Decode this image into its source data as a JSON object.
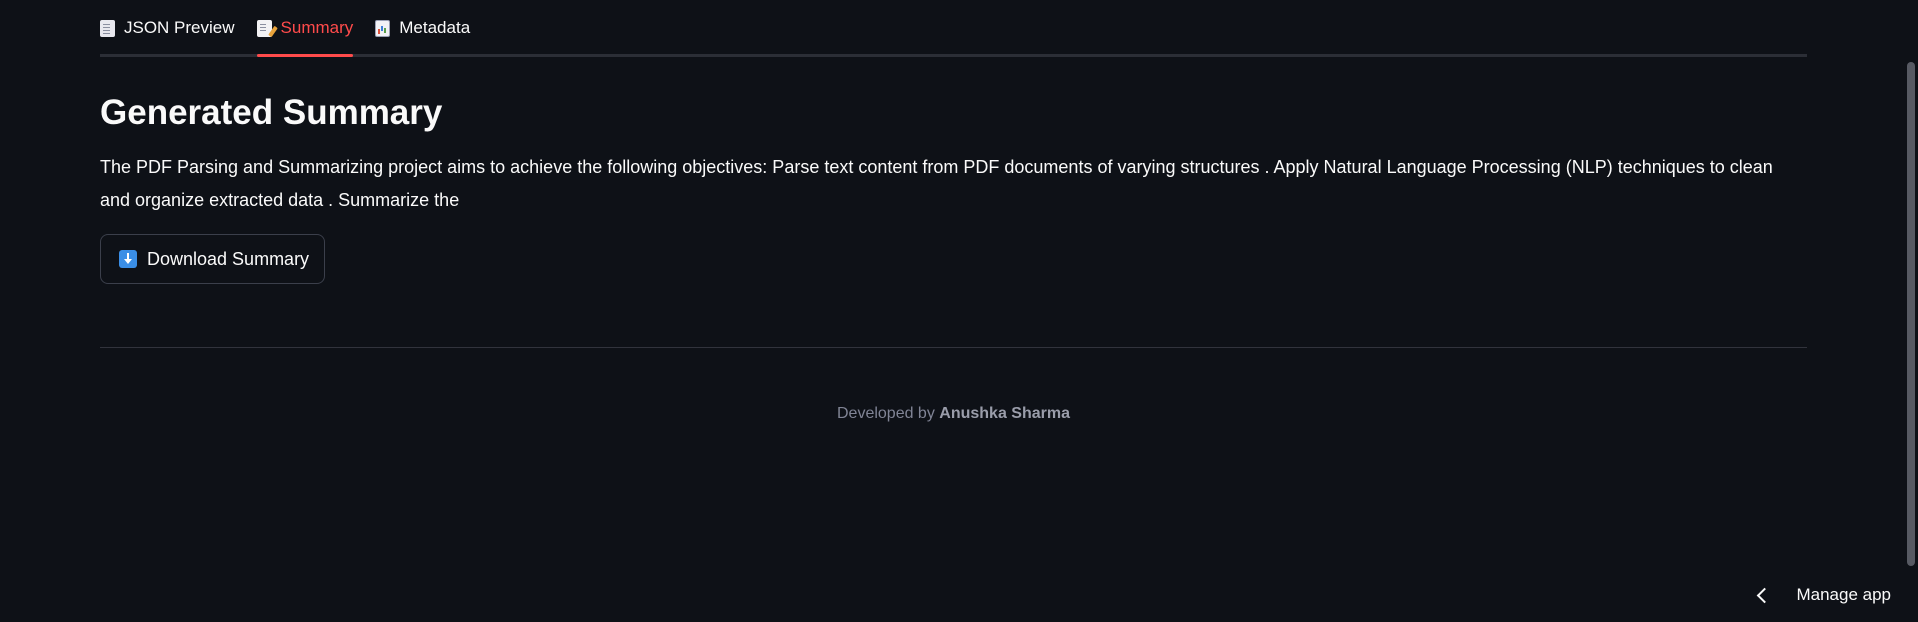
{
  "tabs": [
    {
      "label": "JSON Preview",
      "icon": "document-icon",
      "active": false
    },
    {
      "label": "Summary",
      "icon": "memo-icon",
      "active": true
    },
    {
      "label": "Metadata",
      "icon": "bar-chart-icon",
      "active": false
    }
  ],
  "main": {
    "title": "Generated Summary",
    "summary_text": "The PDF Parsing and Summarizing project aims to achieve the following objectives: Parse text content from PDF documents of varying structures . Apply Natural Language Processing (NLP) techniques to clean and organize extracted data . Summarize the",
    "download_button_label": "Download Summary",
    "download_button_icon": "down-arrow-icon"
  },
  "footer": {
    "prefix": "Developed by ",
    "author": "Anushka Sharma"
  },
  "manage_app": {
    "label": "Manage app",
    "icon": "chevron-left-icon"
  },
  "colors": {
    "background": "#0e1117",
    "accent": "#ff4b4b",
    "text": "#fafafa",
    "muted": "#808495"
  }
}
